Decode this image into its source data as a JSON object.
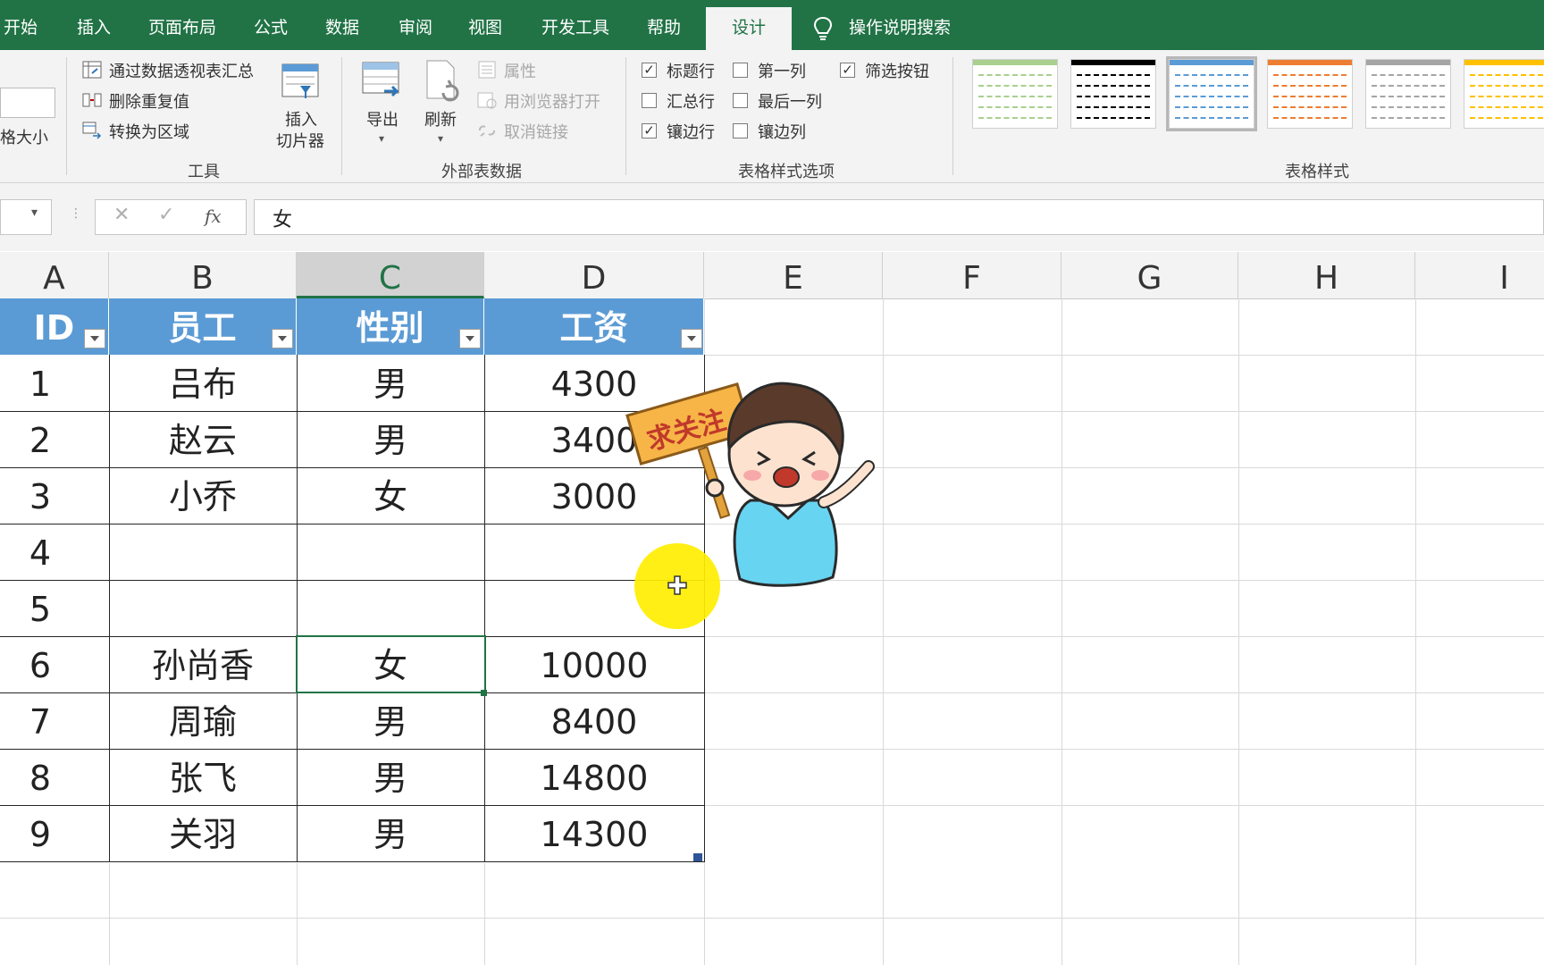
{
  "tabs": [
    {
      "label": "开始",
      "active": false
    },
    {
      "label": "插入",
      "active": false
    },
    {
      "label": "页面布局",
      "active": false
    },
    {
      "label": "公式",
      "active": false
    },
    {
      "label": "数据",
      "active": false
    },
    {
      "label": "审阅",
      "active": false
    },
    {
      "label": "视图",
      "active": false
    },
    {
      "label": "开发工具",
      "active": false
    },
    {
      "label": "帮助",
      "active": false
    },
    {
      "label": "设计",
      "active": true
    }
  ],
  "tell_me": "操作说明搜索",
  "ribbon": {
    "properties_partial": "格大小",
    "tools": {
      "summarize_pivot": "通过数据透视表汇总",
      "remove_duplicates": "删除重复值",
      "convert_range": "转换为区域",
      "insert_slicer_line1": "插入",
      "insert_slicer_line2": "切片器",
      "group_label": "工具"
    },
    "external": {
      "export": "导出",
      "refresh": "刷新",
      "properties": "属性",
      "open_browser": "用浏览器打开",
      "unlink": "取消链接",
      "group_label": "外部表数据"
    },
    "style_options": {
      "header_row": {
        "label": "标题行",
        "checked": true
      },
      "total_row": {
        "label": "汇总行",
        "checked": false
      },
      "banded_rows": {
        "label": "镶边行",
        "checked": true
      },
      "first_column": {
        "label": "第一列",
        "checked": false
      },
      "last_column": {
        "label": "最后一列",
        "checked": false
      },
      "banded_columns": {
        "label": "镶边列",
        "checked": false
      },
      "filter_button": {
        "label": "筛选按钮",
        "checked": true
      },
      "group_label": "表格样式选项"
    },
    "styles": {
      "group_label": "表格样式",
      "swatches": [
        "#a9d08e",
        "#000000",
        "#5b9bd5",
        "#ed7d31",
        "#a5a5a5",
        "#ffc000"
      ]
    }
  },
  "formula_bar": {
    "cancel": "✕",
    "enter": "✓",
    "fx": "fx",
    "value": "女"
  },
  "columns": [
    "A",
    "B",
    "C",
    "D",
    "E",
    "F",
    "G",
    "H",
    "I"
  ],
  "table": {
    "headers": [
      "ID",
      "员工",
      "性别",
      "工资"
    ],
    "rows": [
      [
        "1",
        "吕布",
        "男",
        "4300"
      ],
      [
        "2",
        "赵云",
        "男",
        "3400"
      ],
      [
        "3",
        "小乔",
        "女",
        "3000"
      ],
      [
        "4",
        "",
        "",
        ""
      ],
      [
        "5",
        "",
        "",
        ""
      ],
      [
        "6",
        "孙尚香",
        "女",
        "10000"
      ],
      [
        "7",
        "周瑜",
        "男",
        "8400"
      ],
      [
        "8",
        "张飞",
        "男",
        "14800"
      ],
      [
        "9",
        "关羽",
        "男",
        "14300"
      ]
    ]
  },
  "sticker_sign": "求关注",
  "colors": {
    "accent": "#217346",
    "table_header": "#5b9bd5",
    "cursor_highlight": "#ffee00"
  }
}
